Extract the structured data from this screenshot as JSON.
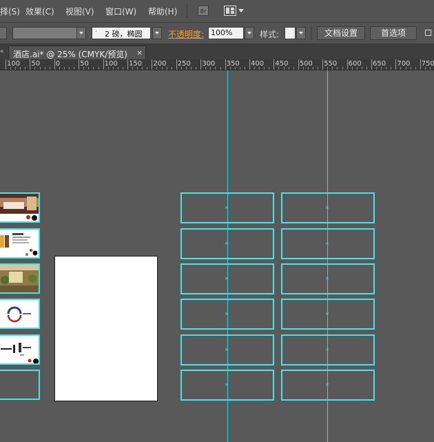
{
  "menubar": {
    "items": [
      "择(S)",
      "效果(C)",
      "视图(V)",
      "窗口(W)",
      "帮助(H)"
    ],
    "bridge_icon_label": "Br"
  },
  "controlbar": {
    "stroke_weight_value": "2 磅，椭圆",
    "opacity_label": "不透明度:",
    "opacity_value": "100%",
    "style_label": "样式:",
    "doc_setup_button": "文档设置",
    "preferences_button": "首选项"
  },
  "tabs": {
    "document_tab": "酒店.ai* @ 25% (CMYK/预览)",
    "close_glyph": "×"
  },
  "ruler": {
    "labels": [
      "100",
      "50",
      "0",
      "50",
      "100",
      "150",
      "200",
      "250",
      "300",
      "350",
      "400",
      "450",
      "500",
      "550",
      "600",
      "650",
      "700",
      "750"
    ]
  },
  "canvas": {
    "thumbnail_artboards": [
      "hotel-room-photo",
      "brochure-layout",
      "lobby-photo",
      "logo-page",
      "contact-page",
      "empty-board"
    ],
    "empty_artboards_left_column_count": 6,
    "empty_artboards_right_column_count": 6,
    "guide_color": "#2fd6e6",
    "artboard_border_color": "#42e6ea",
    "center_mark_glyph": "×"
  },
  "colors": {
    "workspace": "#595959",
    "panel": "#535353",
    "accent_orange": "#f0a030"
  }
}
